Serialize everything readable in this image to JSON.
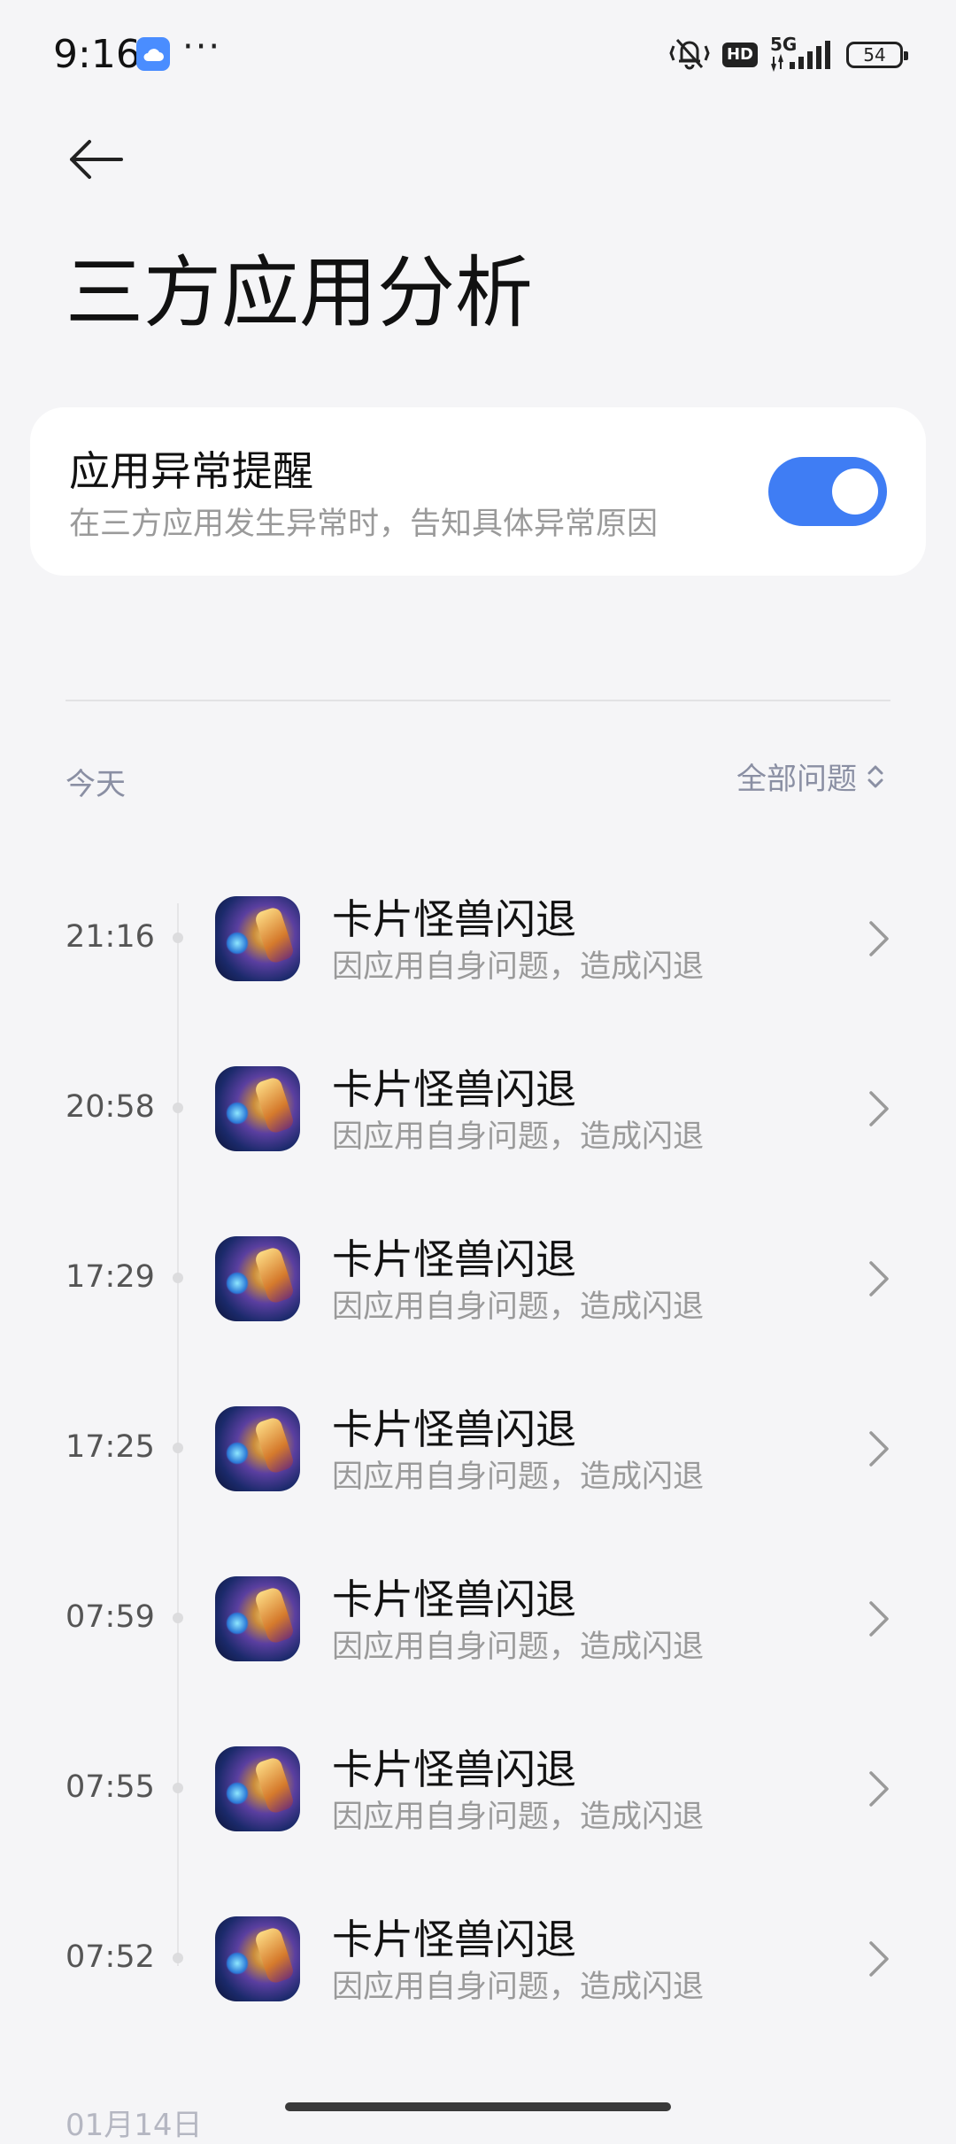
{
  "status_bar": {
    "time": "9:16",
    "dots": "···",
    "network": "5G",
    "hd": "HD",
    "battery": "54"
  },
  "header": {
    "title": "三方应用分析"
  },
  "setting": {
    "title": "应用异常提醒",
    "subtitle": "在三方应用发生异常时，告知具体异常原因",
    "enabled": true,
    "accent": "#3f7df4"
  },
  "list": {
    "section_date": "今天",
    "filter_label": "全部问题",
    "next_section_date": "01月14日",
    "items": [
      {
        "time": "21:16",
        "title": "卡片怪兽闪退",
        "desc": "因应用自身问题，造成闪退"
      },
      {
        "time": "20:58",
        "title": "卡片怪兽闪退",
        "desc": "因应用自身问题，造成闪退"
      },
      {
        "time": "17:29",
        "title": "卡片怪兽闪退",
        "desc": "因应用自身问题，造成闪退"
      },
      {
        "time": "17:25",
        "title": "卡片怪兽闪退",
        "desc": "因应用自身问题，造成闪退"
      },
      {
        "time": "07:59",
        "title": "卡片怪兽闪退",
        "desc": "因应用自身问题，造成闪退"
      },
      {
        "time": "07:55",
        "title": "卡片怪兽闪退",
        "desc": "因应用自身问题，造成闪退"
      },
      {
        "time": "07:52",
        "title": "卡片怪兽闪退",
        "desc": "因应用自身问题，造成闪退"
      }
    ]
  }
}
